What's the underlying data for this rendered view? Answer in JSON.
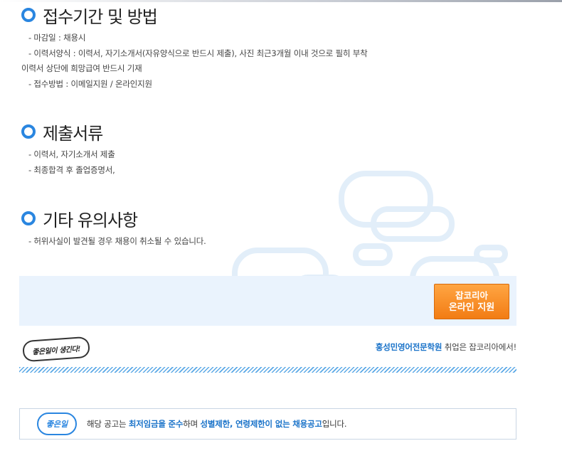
{
  "sections": [
    {
      "title": "접수기간 및 방법",
      "lines": [
        "- 마감일 : 채용시",
        "- 이력서양식 : 이력서, 자기소개서(자유양식으로 반드시 제출), 사진 최근3개월 이내 것으로 필히 부착",
        "이력서 상단에 희망급여 반드시 기재",
        "- 접수방법 : 이메일지원 / 온라인지원"
      ]
    },
    {
      "title": "제출서류",
      "lines": [
        "- 이력서, 자기소개서 제출",
        "- 최종합격 후 졸업증명서,"
      ]
    },
    {
      "title": "기타 유의사항",
      "lines": [
        "- 허위사실이 발견될 경우 채용이 취소될 수 있습니다."
      ]
    }
  ],
  "apply_button": {
    "line1": "잡코리아",
    "line2": "온라인 지원"
  },
  "stamp": {
    "text": "좋은일이 생긴다!",
    "icon": "good-job-stamp-icon"
  },
  "credit": {
    "company": "홍성민영어전문학원",
    "suffix": " 취업은 잡코리아에서!"
  },
  "notice": {
    "badge": "좋은일",
    "parts": [
      {
        "text": "해당 공고는 ",
        "hl": false
      },
      {
        "text": "최저임금을 준수",
        "hl": true
      },
      {
        "text": "하며 ",
        "hl": false
      },
      {
        "text": "성별제한, 연령제한이 없는 채용공고",
        "hl": true
      },
      {
        "text": "입니다.",
        "hl": false
      }
    ]
  },
  "colors": {
    "accent": "#2a86e0",
    "button": "#f5861c",
    "link": "#1a73c9",
    "panel": "#eaf3fd"
  }
}
